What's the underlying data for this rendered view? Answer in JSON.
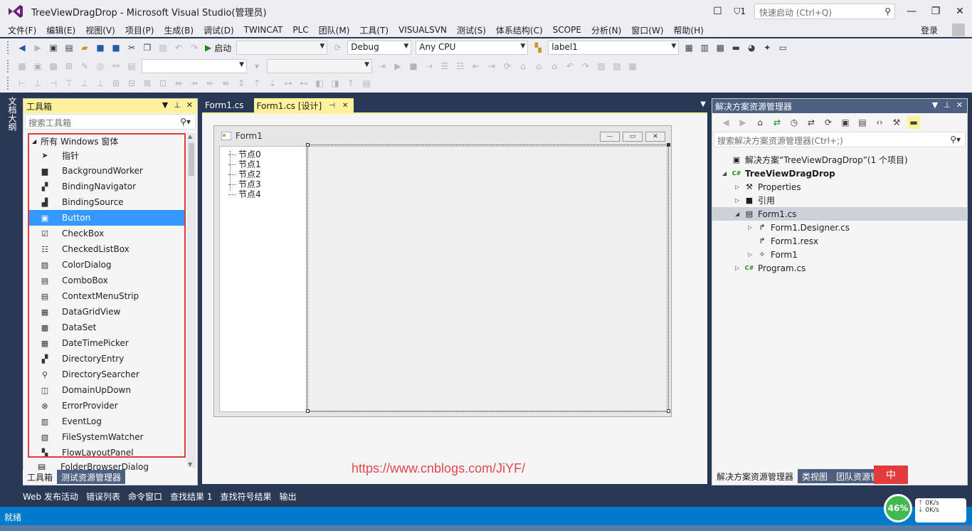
{
  "window": {
    "title": "TreeViewDragDrop - Microsoft Visual Studio(管理员)",
    "notifications": "1",
    "quick_launch_placeholder": "快速启动 (Ctrl+Q)"
  },
  "menu": {
    "items": [
      "文件(F)",
      "编辑(E)",
      "视图(V)",
      "项目(P)",
      "生成(B)",
      "调试(D)",
      "TWINCAT",
      "PLC",
      "团队(M)",
      "工具(T)",
      "VISUALSVN",
      "测试(S)",
      "体系结构(C)",
      "SCOPE",
      "分析(N)",
      "窗口(W)",
      "帮助(H)"
    ],
    "login": "登录"
  },
  "toolbar": {
    "start_label": "启动",
    "config": "Debug",
    "platform": "Any CPU",
    "object": "label1"
  },
  "left_vtab": "文档大纲",
  "toolbox": {
    "title": "工具箱",
    "search_placeholder": "搜索工具箱",
    "category": "所有 Windows 窗体",
    "items": [
      {
        "label": "指针",
        "icon": "pointer-icon"
      },
      {
        "label": "BackgroundWorker",
        "icon": "background-worker-icon"
      },
      {
        "label": "BindingNavigator",
        "icon": "binding-navigator-icon"
      },
      {
        "label": "BindingSource",
        "icon": "binding-source-icon"
      },
      {
        "label": "Button",
        "icon": "button-icon"
      },
      {
        "label": "CheckBox",
        "icon": "checkbox-icon"
      },
      {
        "label": "CheckedListBox",
        "icon": "checked-listbox-icon"
      },
      {
        "label": "ColorDialog",
        "icon": "color-dialog-icon"
      },
      {
        "label": "ComboBox",
        "icon": "combobox-icon"
      },
      {
        "label": "ContextMenuStrip",
        "icon": "context-menu-icon"
      },
      {
        "label": "DataGridView",
        "icon": "datagrid-icon"
      },
      {
        "label": "DataSet",
        "icon": "dataset-icon"
      },
      {
        "label": "DateTimePicker",
        "icon": "datetime-picker-icon"
      },
      {
        "label": "DirectoryEntry",
        "icon": "directory-entry-icon"
      },
      {
        "label": "DirectorySearcher",
        "icon": "directory-searcher-icon"
      },
      {
        "label": "DomainUpDown",
        "icon": "domain-updown-icon"
      },
      {
        "label": "ErrorProvider",
        "icon": "error-provider-icon"
      },
      {
        "label": "EventLog",
        "icon": "eventlog-icon"
      },
      {
        "label": "FileSystemWatcher",
        "icon": "filesystem-watcher-icon"
      },
      {
        "label": "FlowLayoutPanel",
        "icon": "flow-layout-icon"
      }
    ],
    "next_item": "FolderBrowserDialog",
    "bottom_tabs": [
      "工具箱",
      "测试资源管理器"
    ]
  },
  "editor": {
    "tabs": [
      "Form1.cs",
      "Form1.cs [设计]"
    ],
    "form_title": "Form1",
    "tree_nodes": [
      "节点0",
      "节点1",
      "节点2",
      "节点3",
      "节点4"
    ],
    "watermark": "https://www.cnblogs.com/JiYF/"
  },
  "solution_explorer": {
    "title": "解决方案资源管理器",
    "search_placeholder": "搜索解决方案资源管理器(Ctrl+;)",
    "nodes": [
      {
        "label": "解决方案“TreeViewDragDrop”(1 个项目)",
        "icon": "solution-icon",
        "expander": "",
        "indent": 0,
        "bold": false,
        "selected": false
      },
      {
        "label": "TreeViewDragDrop",
        "icon": "csharp-project-icon",
        "expander": "◢",
        "indent": 0,
        "bold": true,
        "selected": false
      },
      {
        "label": "Properties",
        "icon": "wrench-icon",
        "expander": "▷",
        "indent": 1,
        "bold": false,
        "selected": false
      },
      {
        "label": "引用",
        "icon": "references-icon",
        "expander": "▷",
        "indent": 1,
        "bold": false,
        "selected": false
      },
      {
        "label": "Form1.cs",
        "icon": "form-icon",
        "expander": "◢",
        "indent": 1,
        "bold": false,
        "selected": true
      },
      {
        "label": "Form1.Designer.cs",
        "icon": "designer-file-icon",
        "expander": "▷",
        "indent": 2,
        "bold": false,
        "selected": false
      },
      {
        "label": "Form1.resx",
        "icon": "resx-file-icon",
        "expander": "",
        "indent": 2,
        "bold": false,
        "selected": false
      },
      {
        "label": "Form1",
        "icon": "class-icon",
        "expander": "▷",
        "indent": 2,
        "bold": false,
        "selected": false
      },
      {
        "label": "Program.cs",
        "icon": "csharp-file-icon",
        "expander": "▷",
        "indent": 1,
        "bold": false,
        "selected": false
      }
    ],
    "bottom_tabs": [
      "解决方案资源管理器",
      "类视图",
      "团队资源管"
    ]
  },
  "bottom_panels": [
    "Web 发布活动",
    "错误列表",
    "命令窗口",
    "查找结果 1",
    "查找符号结果",
    "输出"
  ],
  "status": "就绪",
  "widget": {
    "percent": "46%",
    "up": "0K/s",
    "down": "0K/s",
    "ime": "中"
  },
  "colors": {
    "accent_yellow": "#fff29d",
    "frame_blue": "#293955",
    "status_blue": "#007acc",
    "selection_blue": "#3399ff",
    "highlight_red": "#e33b3b"
  }
}
